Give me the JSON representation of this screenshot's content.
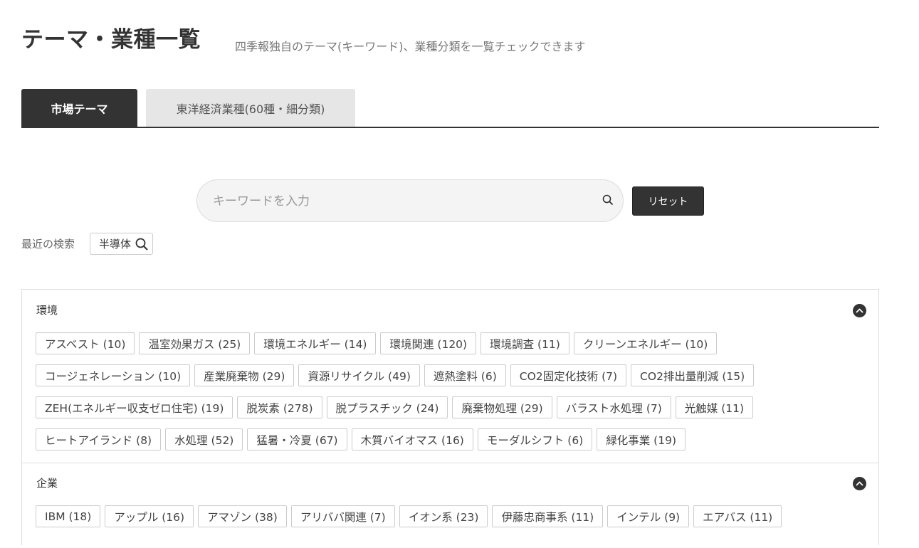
{
  "header": {
    "title": "テーマ・業種一覧",
    "subtitle": "四季報独自のテーマ(キーワード)、業種分類を一覧チェックできます"
  },
  "tabs": [
    {
      "label": "市場テーマ",
      "active": true
    },
    {
      "label": "東洋経済業種(60種・細分類)",
      "active": false
    }
  ],
  "search": {
    "placeholder": "キーワードを入力",
    "value": "",
    "reset_label": "リセット"
  },
  "recent": {
    "label": "最近の検索",
    "items": [
      "半導体"
    ]
  },
  "sections": [
    {
      "title": "環境",
      "expanded": true,
      "rows": [
        [
          "アスベスト (10)",
          "温室効果ガス (25)",
          "環境エネルギー (14)",
          "環境関連 (120)",
          "環境調査 (11)",
          "クリーンエネルギー (10)"
        ],
        [
          "コージェネレーション (10)",
          "産業廃棄物 (29)",
          "資源リサイクル (49)",
          "遮熱塗料 (6)",
          "CO2固定化技術 (7)",
          "CO2排出量削減 (15)"
        ],
        [
          "ZEH(エネルギー収支ゼロ住宅) (19)",
          "脱炭素 (278)",
          "脱プラスチック (24)",
          "廃棄物処理 (29)",
          "バラスト水処理 (7)",
          "光触媒 (11)"
        ],
        [
          "ヒートアイランド (8)",
          "水処理 (52)",
          "猛暑・冷夏 (67)",
          "木質バイオマス (16)",
          "モーダルシフト (6)",
          "緑化事業 (19)"
        ]
      ]
    },
    {
      "title": "企業",
      "expanded": true,
      "rows": [
        [
          "IBM (18)",
          "アップル (16)",
          "アマゾン (38)",
          "アリババ関連 (7)",
          "イオン系 (23)",
          "伊藤忠商事系 (11)",
          "インテル (9)",
          "エアバス (11)"
        ]
      ]
    }
  ],
  "colors": {
    "accent": "#333333",
    "tab_inactive": "#e6e6e6",
    "border": "#dddddd"
  }
}
